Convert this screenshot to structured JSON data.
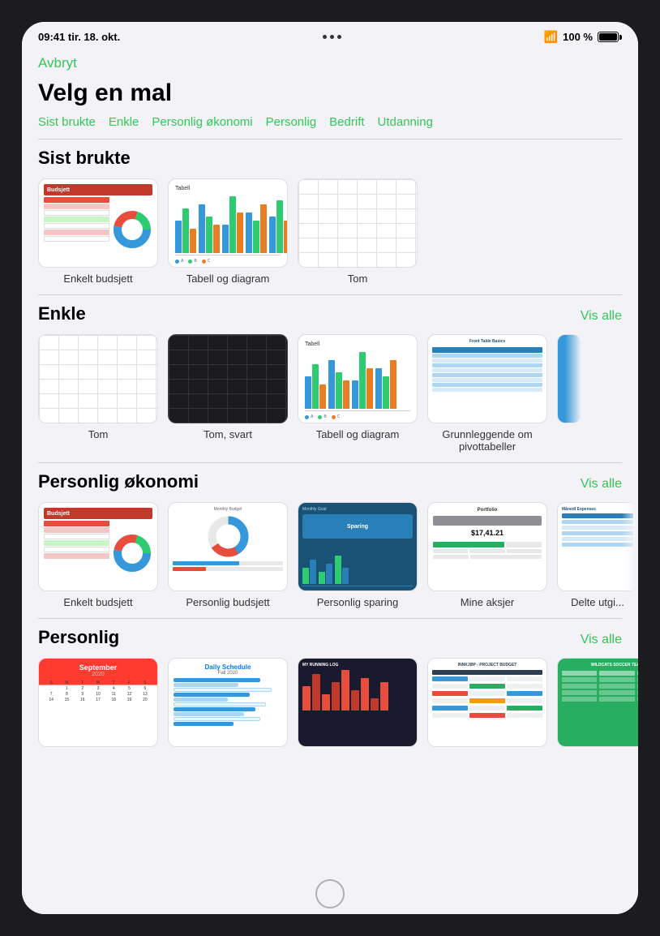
{
  "statusBar": {
    "time": "09:41",
    "date": "tir. 18. okt.",
    "wifi": "WiFi",
    "battery": "100 %"
  },
  "header": {
    "cancelLabel": "Avbryt",
    "pageTitle": "Velg en mal"
  },
  "navTabs": [
    {
      "id": "sist-brukte",
      "label": "Sist brukte"
    },
    {
      "id": "enkle",
      "label": "Enkle"
    },
    {
      "id": "personlig-okonomi",
      "label": "Personlig økonomi"
    },
    {
      "id": "personlig",
      "label": "Personlig"
    },
    {
      "id": "bedrift",
      "label": "Bedrift"
    },
    {
      "id": "utdanning",
      "label": "Utdanning"
    }
  ],
  "sections": {
    "sistBrukte": {
      "title": "Sist brukte",
      "templates": [
        {
          "id": "enkelt-budsjett-1",
          "label": "Enkelt budsjett"
        },
        {
          "id": "tabell-og-diagram-1",
          "label": "Tabell og diagram"
        },
        {
          "id": "tom-1",
          "label": "Tom"
        }
      ]
    },
    "enkle": {
      "title": "Enkle",
      "viewAllLabel": "Vis alle",
      "templates": [
        {
          "id": "tom-2",
          "label": "Tom"
        },
        {
          "id": "tom-svart",
          "label": "Tom, svart"
        },
        {
          "id": "tabell-og-diagram-2",
          "label": "Tabell og diagram"
        },
        {
          "id": "grunnleggende-pivottabeller",
          "label": "Grunnleggende om pivottabeller"
        },
        {
          "id": "more-enkle",
          "label": "..."
        }
      ]
    },
    "personligOkonomi": {
      "title": "Personlig økonomi",
      "viewAllLabel": "Vis alle",
      "templates": [
        {
          "id": "enkelt-budsjett-2",
          "label": "Enkelt budsjett"
        },
        {
          "id": "personlig-budsjett",
          "label": "Personlig budsjett"
        },
        {
          "id": "personlig-sparing",
          "label": "Personlig sparing"
        },
        {
          "id": "mine-aksjer",
          "label": "Mine aksjer"
        },
        {
          "id": "delte-utgifter",
          "label": "Delte utgi..."
        }
      ]
    },
    "personlig": {
      "title": "Personlig",
      "viewAllLabel": "Vis alle",
      "templates": [
        {
          "id": "kalender",
          "label": ""
        },
        {
          "id": "daglig-timeplan",
          "label": ""
        },
        {
          "id": "lope-logg",
          "label": ""
        },
        {
          "id": "prosjekt-budsjett",
          "label": ""
        },
        {
          "id": "fotball-lag",
          "label": ""
        }
      ]
    }
  }
}
